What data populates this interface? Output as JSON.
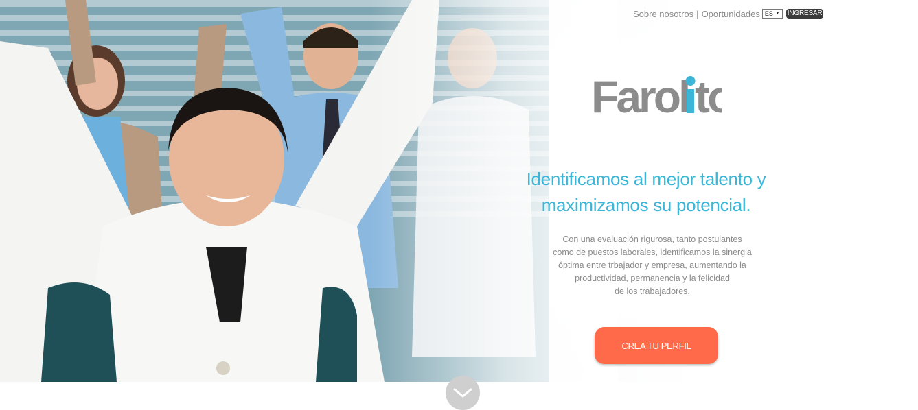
{
  "nav": {
    "about": "Sobre nosotros",
    "separator": "|",
    "opportunities": "Oportunidades",
    "language": "ES",
    "login": "INGRESAR"
  },
  "brand": {
    "name": "Farolito",
    "color_gray": "#8c8c8c",
    "color_accent": "#3bb6d9"
  },
  "hero": {
    "headline_line1": "Identificamos al mejor talento y",
    "headline_line2": "maximizamos su potencial.",
    "body_lines": [
      "Con una evaluación rigurosa, tanto postulantes",
      "como de puestos laborales, identificamos la sinergia",
      "óptima entre trbajador y empresa, aumentando la",
      "productividad, permanencia y la felicidad",
      "de los trabajadores."
    ],
    "cta_label": "CREA TU PERFIL",
    "cta_color": "#ff6b4a"
  },
  "icons": {
    "scroll_down": "chevron-down-icon",
    "language_caret": "caret-down-icon"
  }
}
